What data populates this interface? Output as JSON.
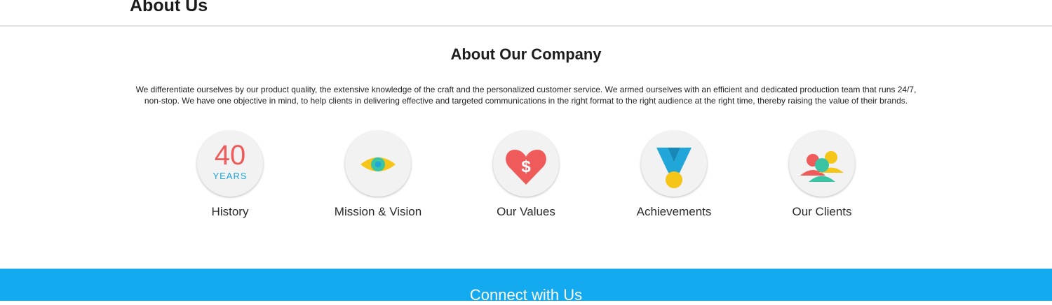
{
  "header": {
    "title": "About Us"
  },
  "about": {
    "title": "About Our Company",
    "description": "We differentiate ourselves by our product quality, the extensive knowledge of the craft and the personalized customer service. We armed ourselves with an efficient and dedicated production team that runs 24/7, non-stop. We have one objective in mind, to help clients in delivering effective and targeted communications in the right format to the right audience at the right time, thereby raising the value of their brands."
  },
  "features": [
    {
      "label": "History",
      "icon": "years-counter-icon",
      "number": "40",
      "unit": "YEARS"
    },
    {
      "label": "Mission & Vision",
      "icon": "eye-icon"
    },
    {
      "label": "Our Values",
      "icon": "heart-dollar-icon"
    },
    {
      "label": "Achievements",
      "icon": "medal-icon"
    },
    {
      "label": "Our Clients",
      "icon": "people-group-icon"
    }
  ],
  "footer": {
    "connect_title": "Connect with Us"
  },
  "colors": {
    "accent_blue": "#14aaf0",
    "red": "#ef5b5b",
    "teal": "#21a6d9",
    "yellow": "#f5c518",
    "green": "#3bc4a4"
  }
}
